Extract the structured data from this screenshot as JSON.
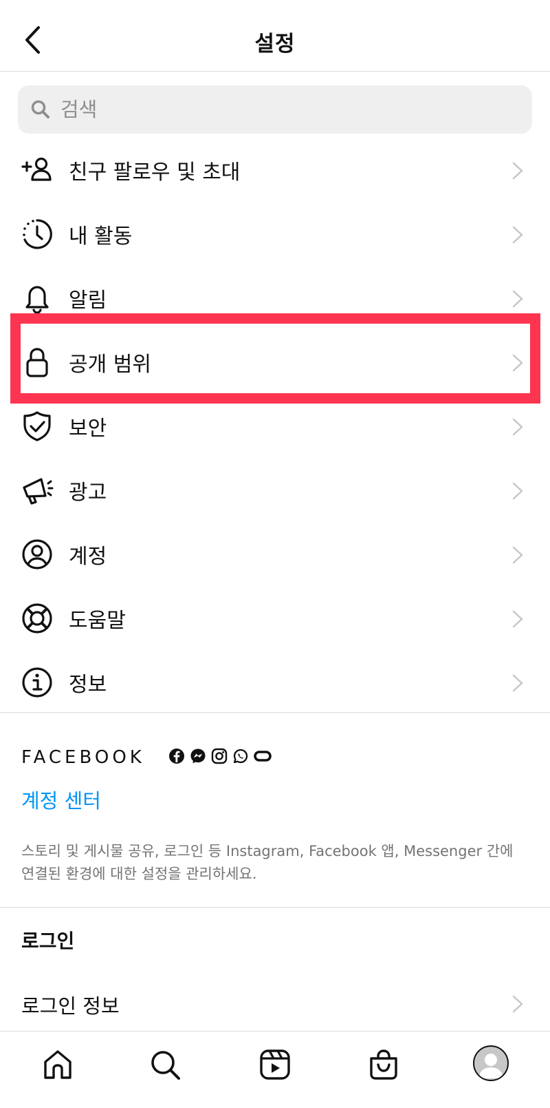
{
  "header": {
    "title": "설정",
    "back_icon": "chevron-left-icon"
  },
  "search": {
    "placeholder": "검색",
    "icon": "search-icon"
  },
  "menu": {
    "items": [
      {
        "label": "친구 팔로우 및 초대",
        "icon": "add-person-icon"
      },
      {
        "label": "내 활동",
        "icon": "activity-clock-icon"
      },
      {
        "label": "알림",
        "icon": "bell-icon"
      },
      {
        "label": "공개 범위",
        "icon": "lock-icon"
      },
      {
        "label": "보안",
        "icon": "shield-check-icon"
      },
      {
        "label": "광고",
        "icon": "megaphone-icon"
      },
      {
        "label": "계정",
        "icon": "account-circle-icon"
      },
      {
        "label": "도움말",
        "icon": "lifebuoy-icon"
      },
      {
        "label": "정보",
        "icon": "info-icon"
      }
    ],
    "highlighted_item": "공개 범위",
    "highlight_color": "#fe3550"
  },
  "facebook": {
    "brand": "FACEBOOK",
    "app_icons": [
      "facebook-icon",
      "messenger-icon",
      "instagram-icon",
      "whatsapp-icon",
      "oculus-icon"
    ],
    "accounts_center_link": "계정 센터",
    "description": "스토리 및 게시물 공유, 로그인 등 Instagram, Facebook 앱, Messenger 간에 연결된 환경에 대한 설정을 관리하세요.",
    "link_color": "#0095f6"
  },
  "login": {
    "section_title": "로그인",
    "login_info_label": "로그인 정보"
  },
  "tabbar": {
    "tabs": [
      "home-icon",
      "search-icon",
      "reels-icon",
      "shop-icon",
      "profile-avatar"
    ]
  }
}
